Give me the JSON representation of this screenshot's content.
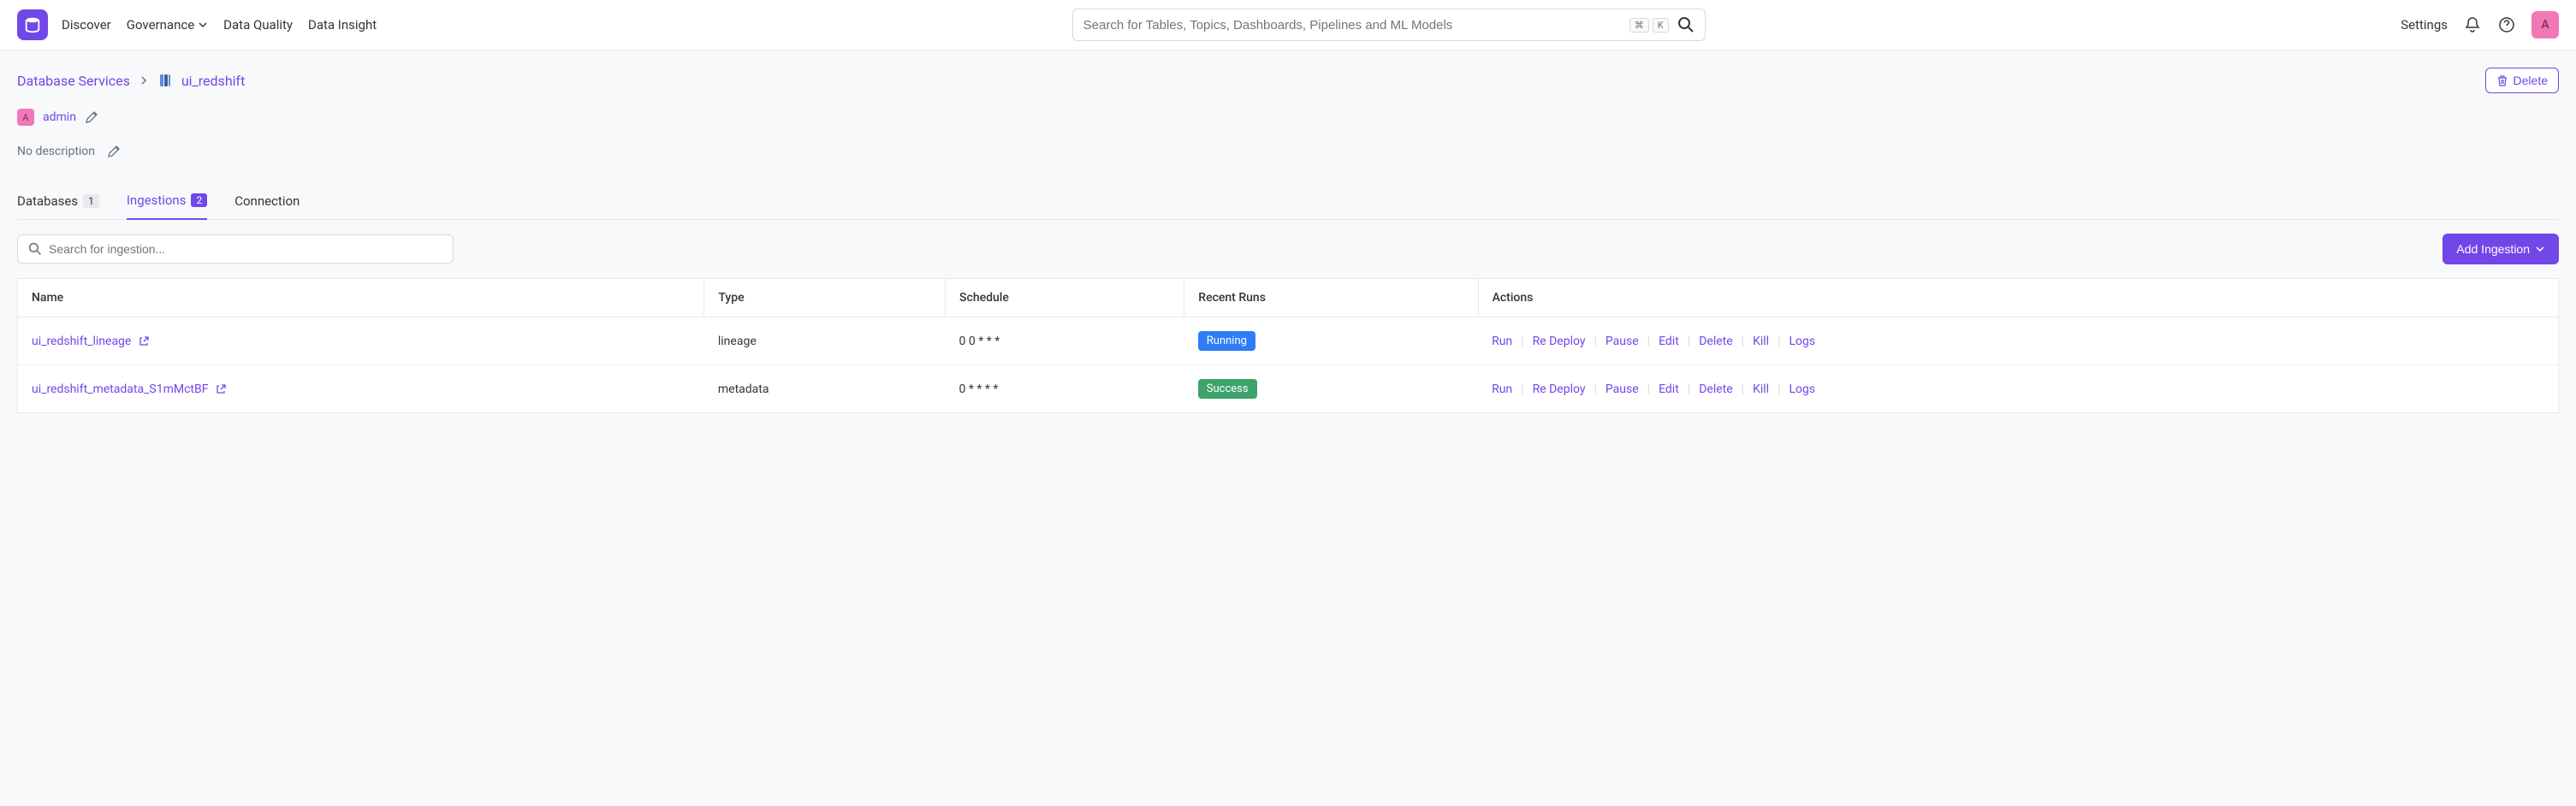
{
  "header": {
    "nav": {
      "discover": "Discover",
      "governance": "Governance",
      "dataQuality": "Data Quality",
      "dataInsight": "Data Insight"
    },
    "search": {
      "placeholder": "Search for Tables, Topics, Dashboards, Pipelines and ML Models",
      "kbd1": "⌘",
      "kbd2": "K"
    },
    "settings": "Settings",
    "avatar": "A"
  },
  "breadcrumb": {
    "root": "Database Services",
    "current": "ui_redshift"
  },
  "deleteBtn": "Delete",
  "owner": {
    "avatar": "A",
    "name": "admin"
  },
  "description": "No description",
  "tabs": {
    "databases": {
      "label": "Databases",
      "count": "1"
    },
    "ingestions": {
      "label": "Ingestions",
      "count": "2"
    },
    "connection": {
      "label": "Connection"
    }
  },
  "ingestionSearch": {
    "placeholder": "Search for ingestion..."
  },
  "addBtn": "Add Ingestion",
  "tableHeaders": {
    "name": "Name",
    "type": "Type",
    "schedule": "Schedule",
    "recentRuns": "Recent Runs",
    "actions": "Actions"
  },
  "rows": [
    {
      "name": "ui_redshift_lineage",
      "type": "lineage",
      "schedule": "0 0 * * *",
      "status": "Running",
      "statusClass": "running"
    },
    {
      "name": "ui_redshift_metadata_S1mMctBF",
      "type": "metadata",
      "schedule": "0 * * * *",
      "status": "Success",
      "statusClass": "success"
    }
  ],
  "actionLabels": {
    "run": "Run",
    "redeploy": "Re Deploy",
    "pause": "Pause",
    "edit": "Edit",
    "delete": "Delete",
    "kill": "Kill",
    "logs": "Logs"
  }
}
